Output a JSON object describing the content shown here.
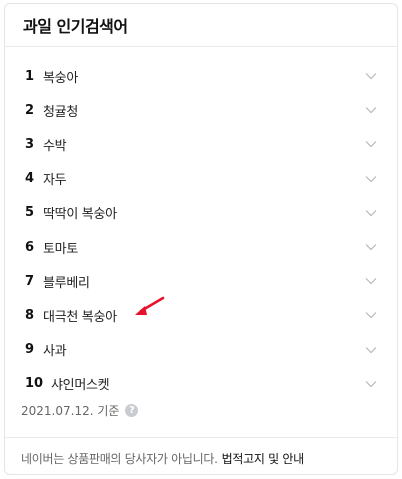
{
  "header": {
    "title": "과일 인기검색어"
  },
  "items": [
    {
      "rank": "1",
      "keyword": "복숭아"
    },
    {
      "rank": "2",
      "keyword": "청귤청"
    },
    {
      "rank": "3",
      "keyword": "수박"
    },
    {
      "rank": "4",
      "keyword": "자두"
    },
    {
      "rank": "5",
      "keyword": "딱딱이 복숭아"
    },
    {
      "rank": "6",
      "keyword": "토마토"
    },
    {
      "rank": "7",
      "keyword": "블루베리"
    },
    {
      "rank": "8",
      "keyword": "대극천 복숭아"
    },
    {
      "rank": "9",
      "keyword": "사과"
    },
    {
      "rank": "10",
      "keyword": "샤인머스켓"
    }
  ],
  "date_note": "2021.07.12. 기준",
  "help_symbol": "?",
  "footer": {
    "notice": "네이버는 상품판매의 당사자가 아닙니다.",
    "link_label": "법적고지 및 안내"
  },
  "colors": {
    "arrow": "#e8112d",
    "chevron": "#b5b8bd"
  }
}
